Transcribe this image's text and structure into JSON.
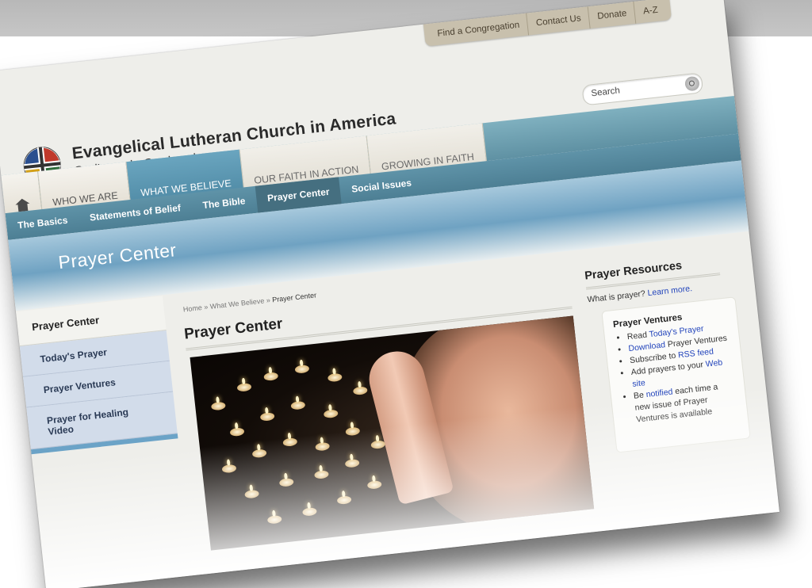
{
  "util_nav": [
    "Find a Congregation",
    "Contact Us",
    "Donate",
    "A-Z"
  ],
  "logo": {
    "title": "Evangelical Lutheran Church in America",
    "tagline": "God's work. Our hands."
  },
  "search": {
    "placeholder": "Search"
  },
  "primary_nav": [
    "WHO WE ARE",
    "WHAT WE BELIEVE",
    "OUR FAITH IN ACTION",
    "GROWING IN FAITH"
  ],
  "secondary_nav": [
    "The Basics",
    "Statements of Belief",
    "The Bible",
    "Prayer Center",
    "Social Issues"
  ],
  "banner_title": "Prayer Center",
  "breadcrumb": {
    "home": "Home",
    "sep": "»",
    "parent": "What We Believe",
    "current": "Prayer Center"
  },
  "left_nav": {
    "heading": "Prayer Center",
    "items": [
      "Today's Prayer",
      "Prayer Ventures",
      "Prayer for Healing Video"
    ]
  },
  "main": {
    "title": "Prayer Center"
  },
  "resources": {
    "title": "Prayer Resources",
    "what_text": "What is prayer?",
    "what_link": "Learn more.",
    "box_title": "Prayer Ventures",
    "items": [
      {
        "pre": "Read ",
        "link": "Today's Prayer",
        "post": ""
      },
      {
        "pre": "",
        "link": "Download",
        "post": " Prayer Ventures"
      },
      {
        "pre": "Subscribe to ",
        "link": "RSS feed",
        "post": ""
      },
      {
        "pre": "Add prayers to your ",
        "link": "Web site",
        "post": ""
      },
      {
        "pre": "Be ",
        "link": "notified",
        "post": " each time a new issue of Prayer Ventures is available"
      }
    ]
  },
  "colors": {
    "teal": "#5f91a3",
    "active_tab": "#6aa5bf",
    "link": "#2244bb"
  }
}
